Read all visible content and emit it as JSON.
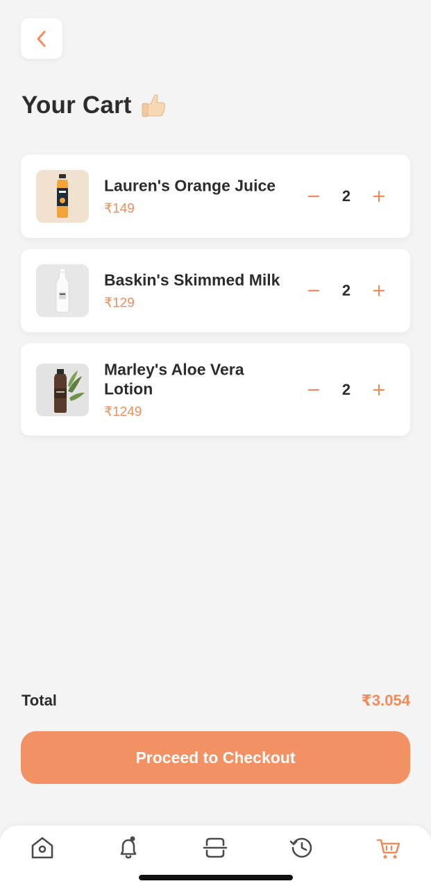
{
  "header": {
    "title": "Your Cart"
  },
  "cart": {
    "items": [
      {
        "name": "Lauren's Orange Juice",
        "price": "₹149",
        "quantity": "2",
        "icon": "orange-juice-bottle"
      },
      {
        "name": "Baskin's Skimmed Milk",
        "price": "₹129",
        "quantity": "2",
        "icon": "milk-bottle"
      },
      {
        "name": "Marley's Aloe Vera Lotion",
        "price": "₹1249",
        "quantity": "2",
        "icon": "lotion-bottle"
      }
    ]
  },
  "summary": {
    "total_label": "Total",
    "total_value": "₹3.054"
  },
  "actions": {
    "checkout_label": "Proceed to Checkout"
  },
  "tabs": [
    {
      "name": "home",
      "icon": "home-icon"
    },
    {
      "name": "notifications",
      "icon": "bell-icon"
    },
    {
      "name": "scan",
      "icon": "scan-icon"
    },
    {
      "name": "history",
      "icon": "history-icon"
    },
    {
      "name": "cart",
      "icon": "cart-icon",
      "active": true
    }
  ],
  "colors": {
    "accent": "#f08c5a",
    "button": "#f29163",
    "background": "#f4f4f4",
    "inactive_icon": "#4a4a4a"
  }
}
